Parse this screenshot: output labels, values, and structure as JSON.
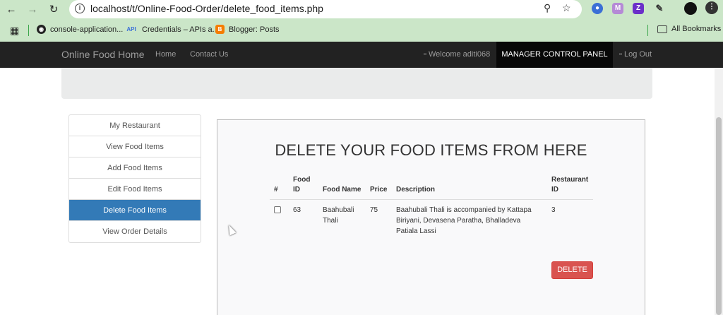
{
  "browser": {
    "url": "localhost/t/Online-Food-Order/delete_food_items.php",
    "bookmarks": [
      {
        "label": "console-application..."
      },
      {
        "label": "Credentials – APIs a..."
      },
      {
        "label": "Blogger: Posts"
      }
    ],
    "all_bookmarks": "All Bookmarks"
  },
  "navbar": {
    "brand": "Online Food Home",
    "home": "Home",
    "contact": "Contact Us",
    "welcome": "Welcome aditi068",
    "panel": "MANAGER CONTROL PANEL",
    "logout": "Log Out"
  },
  "sidebar": {
    "items": [
      {
        "label": "My Restaurant"
      },
      {
        "label": "View Food Items"
      },
      {
        "label": "Add Food Items"
      },
      {
        "label": "Edit Food Items"
      },
      {
        "label": "Delete Food Items"
      },
      {
        "label": "View Order Details"
      }
    ]
  },
  "main": {
    "title": "DELETE YOUR FOOD ITEMS FROM HERE",
    "columns": {
      "select": "#",
      "food_id": "Food ID",
      "food_name": "Food Name",
      "price": "Price",
      "description": "Description",
      "restaurant_id": "Restaurant ID"
    },
    "rows": [
      {
        "food_id": "63",
        "food_name": "Baahubali Thali",
        "price": "75",
        "description": "Baahubali Thali is accompanied by Kattapa Biriyani, Devasena Paratha, Bhalladeva Patiala Lassi",
        "restaurant_id": "3"
      }
    ],
    "delete_label": "DELETE"
  },
  "colors": {
    "chrome": "#cbe6c8",
    "navbar": "#222222",
    "active_item": "#337ab7",
    "delete": "#d9534f"
  }
}
